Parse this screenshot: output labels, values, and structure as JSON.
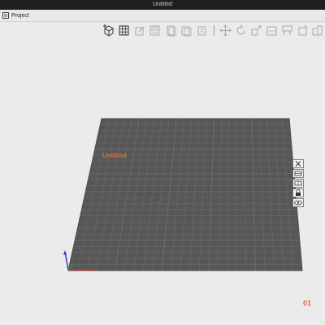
{
  "window": {
    "title": "Untitled"
  },
  "menu": {
    "project_label": "Project"
  },
  "toolbar": {
    "buttons": [
      "add-object",
      "arrange-grid",
      "edit-object",
      "layout",
      "copy",
      "paste",
      "delete",
      "move",
      "rotate",
      "scale",
      "cut",
      "support",
      "seam",
      "assembly"
    ]
  },
  "plate": {
    "name": "Untitled",
    "number": "01"
  },
  "colors": {
    "titlebar": "#1f1f1f",
    "background": "#ebebeb",
    "bed": "#575757",
    "grid": "#6e6e6e",
    "accent": "#e06a45",
    "axis_x": "#d03030",
    "axis_y": "#2f9a2f",
    "axis_z": "#2b3fd8"
  }
}
